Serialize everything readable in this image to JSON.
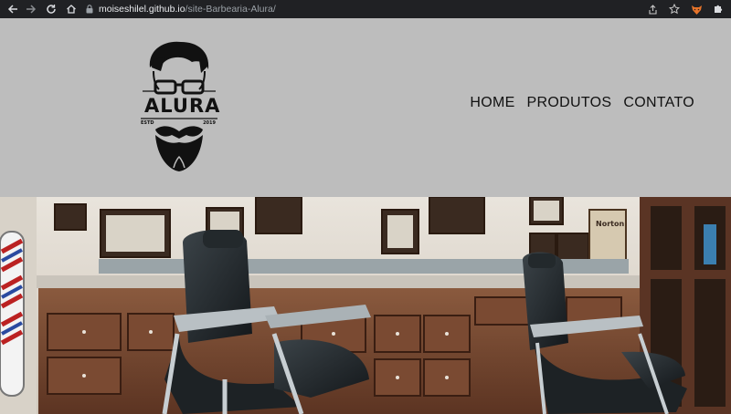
{
  "browser": {
    "url_host": "moiseshilel.github.io",
    "url_path": "/site-Barbearia-Alura/"
  },
  "icons": {
    "back": "arrow-left-icon",
    "forward": "arrow-right-icon",
    "reload": "reload-icon",
    "home": "home-icon",
    "lock": "lock-icon",
    "share": "share-icon",
    "bookmark": "star-icon",
    "extension1": "fox-extension-icon",
    "extension2": "puzzle-icon"
  },
  "header": {
    "logo": {
      "text": "ALURA",
      "estd": "ESTD",
      "year": "2019"
    },
    "menu": [
      "HOME",
      "PRODUTOS",
      "CONTATO"
    ]
  },
  "colors": {
    "header_bg": "#bdbdbd",
    "chrome_bg": "#202124",
    "menu_text": "#111111"
  }
}
